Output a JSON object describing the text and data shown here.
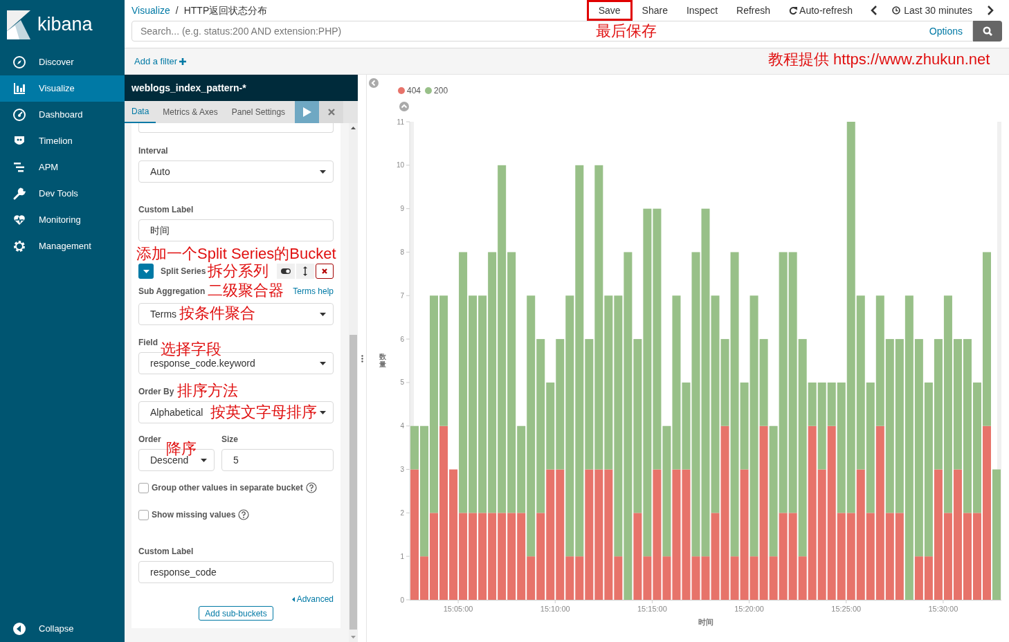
{
  "sidebar": {
    "brand": "kibana",
    "items": [
      {
        "label": "Discover",
        "selected": false
      },
      {
        "label": "Visualize",
        "selected": true
      },
      {
        "label": "Dashboard",
        "selected": false
      },
      {
        "label": "Timelion",
        "selected": false
      },
      {
        "label": "APM",
        "selected": false
      },
      {
        "label": "Dev Tools",
        "selected": false
      },
      {
        "label": "Monitoring",
        "selected": false
      },
      {
        "label": "Management",
        "selected": false
      }
    ],
    "collapse": "Collapse"
  },
  "header": {
    "breadcrumbs": [
      {
        "label": "Visualize",
        "kind": "link"
      },
      {
        "label": "HTTP返回状态分布",
        "kind": "current"
      }
    ],
    "separator": "/",
    "menu": [
      {
        "label": "Save",
        "highlighted": true
      },
      {
        "label": "Share",
        "highlighted": false
      },
      {
        "label": "Inspect",
        "highlighted": false
      },
      {
        "label": "Refresh",
        "highlighted": false
      },
      {
        "label": "Auto-refresh",
        "highlighted": false
      }
    ],
    "time_range": "Last 30 minutes"
  },
  "search": {
    "placeholder": "Search... (e.g. status:200 AND extension:PHP)",
    "options": "Options"
  },
  "filter_bar": {
    "add_filter": "Add a filter"
  },
  "editor": {
    "index_pattern": "weblogs_index_pattern-*",
    "tabs": [
      {
        "label": "Data",
        "selected": true
      },
      {
        "label": "Metrics & Axes",
        "selected": false
      },
      {
        "label": "Panel Settings",
        "selected": false
      }
    ],
    "interval": {
      "label": "Interval",
      "value": "Auto"
    },
    "custom_label": {
      "label": "Custom Label",
      "value": "时间"
    },
    "split_series": {
      "title": "Split Series",
      "expanded": true
    },
    "sub_aggregation": {
      "label": "Sub Aggregation",
      "help": "Terms help",
      "value": "Terms"
    },
    "field": {
      "label": "Field",
      "value": "response_code.keyword"
    },
    "order_by": {
      "label": "Order By",
      "value": "Alphabetical"
    },
    "order": {
      "label": "Order",
      "value": "Descend"
    },
    "size": {
      "label": "Size",
      "value": "5"
    },
    "options": [
      {
        "label": "Group other values in separate bucket",
        "checked": false
      },
      {
        "label": "Show missing values",
        "checked": false
      }
    ],
    "bucket_custom_label": {
      "label": "Custom Label",
      "value": "response_code"
    },
    "advanced": "Advanced",
    "add_sub_buckets": "Add sub-buckets"
  },
  "visualization": {
    "chart_data": {
      "type": "bar",
      "stacked": true,
      "xlabel": "时间",
      "ylabel": "数量",
      "legend": "top",
      "categories": [
        null,
        null,
        null,
        null,
        null,
        "15:05:00",
        null,
        null,
        null,
        null,
        null,
        null,
        null,
        null,
        null,
        "15:10:00",
        null,
        null,
        null,
        null,
        null,
        null,
        null,
        null,
        null,
        "15:15:00",
        null,
        null,
        null,
        null,
        null,
        null,
        null,
        null,
        null,
        "15:20:00",
        null,
        null,
        null,
        null,
        null,
        null,
        null,
        null,
        null,
        "15:25:00",
        null,
        null,
        null,
        null,
        null,
        null,
        null,
        null,
        null,
        "15:30:00",
        null,
        null,
        null,
        null,
        null
      ],
      "series": [
        {
          "name": "404",
          "color": "#e7736a",
          "values": [
            3,
            1,
            2,
            4,
            3,
            2,
            2,
            2,
            2,
            2,
            2,
            2,
            1,
            2,
            3,
            3,
            1,
            1,
            3,
            3,
            3,
            1,
            0,
            2,
            1,
            3,
            1,
            3,
            3,
            1,
            1,
            2,
            4,
            1,
            3,
            1,
            4,
            1,
            2,
            2,
            1,
            4,
            3,
            4,
            2,
            2,
            3,
            2,
            4,
            2,
            2,
            0,
            1,
            1,
            3,
            2,
            3,
            2,
            2,
            4,
            0
          ]
        },
        {
          "name": "200",
          "color": "#98c088",
          "values": [
            1,
            3,
            5,
            3,
            0,
            6,
            5,
            5,
            6,
            8,
            6,
            2,
            6,
            4,
            2,
            3,
            6,
            9,
            3,
            7,
            4,
            6,
            8,
            4,
            8,
            6,
            3,
            4,
            2,
            7,
            8,
            5,
            2,
            7,
            2,
            6,
            2,
            3,
            6,
            6,
            5,
            1,
            2,
            1,
            3,
            9,
            4,
            3,
            3,
            4,
            4,
            7,
            5,
            4,
            3,
            5,
            3,
            4,
            3,
            4,
            3
          ]
        }
      ],
      "ylim": [
        0,
        11
      ],
      "yticks": [
        0,
        1,
        2,
        3,
        4,
        5,
        6,
        7,
        8,
        9,
        10,
        11
      ]
    }
  },
  "annotations": [
    {
      "text": "最后保存"
    },
    {
      "text": "教程提供 https://www.zhukun.net"
    },
    {
      "text": "添加一个Split Series的Bucket"
    },
    {
      "text": "拆分系列"
    },
    {
      "text": "二级聚合器"
    },
    {
      "text": "按条件聚合"
    },
    {
      "text": "选择字段"
    },
    {
      "text": "排序方法"
    },
    {
      "text": "按英文字母排序"
    },
    {
      "text": "降序"
    }
  ]
}
